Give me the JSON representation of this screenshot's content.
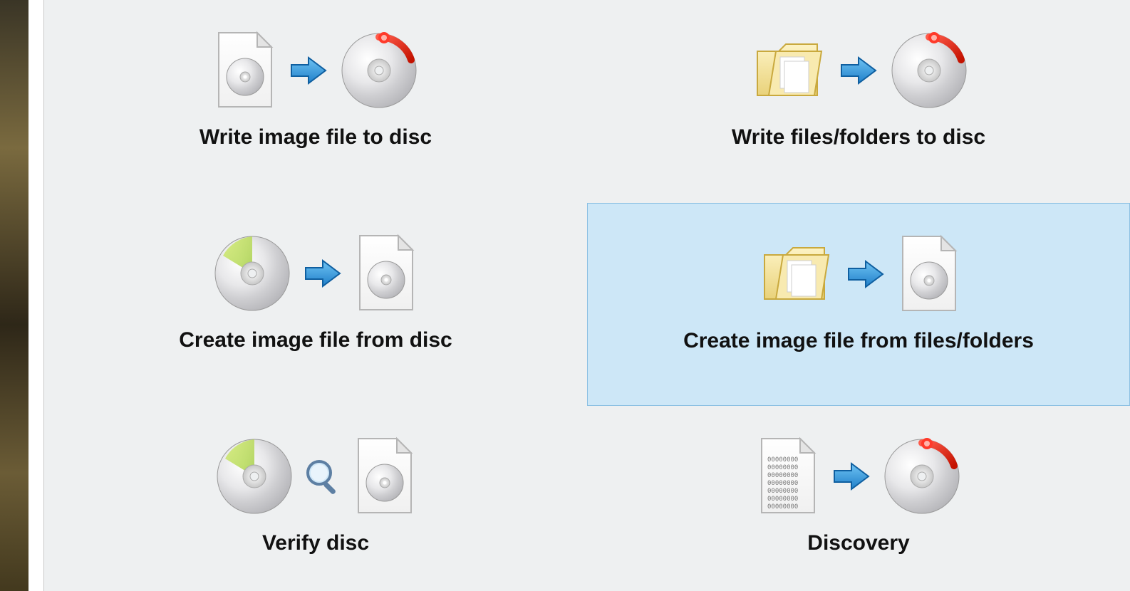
{
  "tiles": [
    {
      "id": "write-image-to-disc",
      "label": "Write image file to disc",
      "selected": false,
      "icons": [
        "file-disc",
        "arrow",
        "disc-burn"
      ]
    },
    {
      "id": "write-files-to-disc",
      "label": "Write files/folders to disc",
      "selected": false,
      "icons": [
        "folder",
        "arrow",
        "disc-burn"
      ]
    },
    {
      "id": "create-image-from-disc",
      "label": "Create image file from disc",
      "selected": false,
      "icons": [
        "disc-plain",
        "arrow",
        "file-disc"
      ]
    },
    {
      "id": "create-image-from-files",
      "label": "Create image file from files/folders",
      "selected": true,
      "icons": [
        "folder",
        "arrow",
        "file-disc"
      ]
    },
    {
      "id": "verify-disc",
      "label": "Verify disc",
      "selected": false,
      "icons": [
        "disc-plain",
        "magnifier",
        "file-disc"
      ]
    },
    {
      "id": "discovery",
      "label": "Discovery",
      "selected": false,
      "icons": [
        "file-binary",
        "arrow",
        "disc-burn"
      ]
    }
  ],
  "colors": {
    "selection_bg": "#cde7f7",
    "selection_border": "#8cc0e3",
    "panel_bg": "#eef0f1"
  }
}
